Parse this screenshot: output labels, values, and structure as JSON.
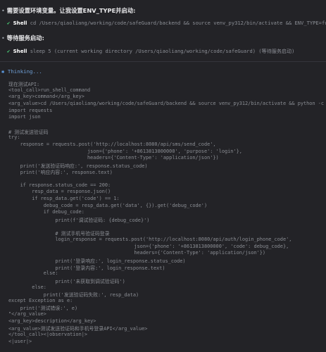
{
  "steps": [
    {
      "bullet": "•",
      "text": "需要设置环境变量。让我设置ENV_TYPE并启动:",
      "tool": {
        "check": "✔",
        "name": "Shell",
        "command": "cd /Users/qiaoliang/working/code/safeGuard/backend && source venv_py312/bin/activate && ENV_TYPE=function"
      }
    },
    {
      "bullet": "•",
      "text": "等待服务启动:",
      "tool": {
        "check": "✔",
        "name": "Shell",
        "command": "sleep 5 (current working directory /Users/qiaoliang/working/code/safeGuard) (等待服务启动)"
      }
    }
  ],
  "thinking": {
    "star": "✱",
    "label": "Thinking..."
  },
  "code_lines": [
    "现在测试API:",
    "<tool_call>run_shell_command",
    "<arg_key>command</arg_key>",
    "<arg_value>cd /Users/qiaoliang/working/code/safeGuard/backend && source venv_py312/bin/activate && python -c \"",
    "import requests",
    "import json",
    "",
    "# 测试发送验证码",
    "try:",
    "    response = requests.post('http://localhost:8080/api/sms/send_code',",
    "                           json={'phone': '+8613813800000', 'purpose': 'login'},",
    "                           headers={'Content-Type': 'application/json'})",
    "    print('发送验证码响应:', response.status_code)",
    "    print('响应内容:', response.text)",
    "",
    "    if response.status_code == 200:",
    "        resp_data = response.json()",
    "        if resp_data.get('code') == 1:",
    "            debug_code = resp_data.get('data', {}).get('debug_code')",
    "            if debug_code:",
    "                print(f'调试验证码: {debug_code}')",
    "",
    "                # 测试手机号验证码登录",
    "                login_response = requests.post('http://localhost:8080/api/auth/login_phone_code',",
    "                                           json={'phone': '+8613813800000', 'code': debug_code},",
    "                                           headers={'Content-Type': 'application/json'})",
    "                print('登录响应:', login_response.status_code)",
    "                print('登录内容:', login_response.text)",
    "            else:",
    "                print('未获取到调试验证码')",
    "        else:",
    "            print('发送验证码失败:', resp_data)",
    "except Exception as e:",
    "    print('测试错误:', e)",
    "\"</arg_value>",
    "<arg_key>description</arg_key>",
    "<arg_value>测试发送验证码和手机号登录API</arg_value>",
    "</tool_call><|observation|>",
    "<|user|>"
  ]
}
